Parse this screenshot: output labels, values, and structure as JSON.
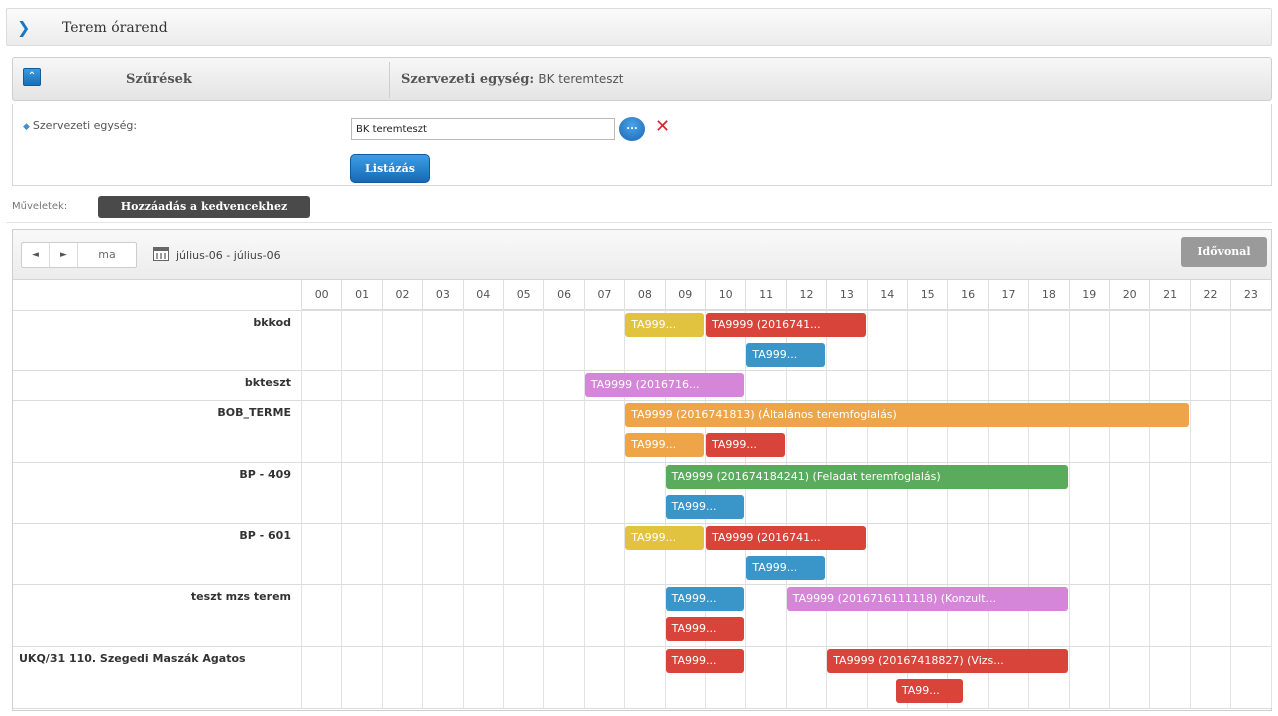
{
  "header": {
    "chevron_icon": "chevron-right-icon",
    "title": "Terem órarend"
  },
  "filters": {
    "collapse_icon": "collapse-up-icon",
    "label": "Szűrések",
    "summary_key": "Szervezeti egység:",
    "summary_value": "BK teremteszt"
  },
  "filter_form": {
    "field_label": "Szervezeti egység:",
    "field_value": "BK teremteszt",
    "browse_label": "...",
    "clear_label": "✕",
    "list_button": "Listázás"
  },
  "operations": {
    "label": "Műveletek:",
    "favorite_button": "Hozzáadás a kedvencekhez"
  },
  "scheduler": {
    "prev_label": "◄",
    "next_label": "►",
    "today_label": "ma",
    "date_range": "július-06 - július-06",
    "timeline_button": "Idővonal",
    "hours": [
      "00",
      "01",
      "02",
      "03",
      "04",
      "05",
      "06",
      "07",
      "08",
      "09",
      "10",
      "11",
      "12",
      "13",
      "14",
      "15",
      "16",
      "17",
      "18",
      "19",
      "20",
      "21",
      "22",
      "23"
    ],
    "colors": {
      "yellow": "#e2c340",
      "red": "#d9443a",
      "blue": "#3a95c8",
      "purple": "#d686d8",
      "orange": "#eea54a",
      "green": "#5aab5c"
    },
    "rows": [
      {
        "name": "bkkod",
        "events": [
          {
            "label": "TA999...",
            "start": 8,
            "end": 10,
            "lane": 0,
            "color": "yellow"
          },
          {
            "label": "TA9999 (2016741...",
            "start": 10,
            "end": 14,
            "lane": 0,
            "color": "red"
          },
          {
            "label": "TA999...",
            "start": 11,
            "end": 13,
            "lane": 1,
            "color": "blue"
          }
        ]
      },
      {
        "name": "bkteszt",
        "events": [
          {
            "label": "TA9999 (2016716...",
            "start": 7,
            "end": 11,
            "lane": 0,
            "color": "purple"
          }
        ]
      },
      {
        "name": "BOB_TERME",
        "events": [
          {
            "label": "TA9999 (2016741813) (Általános teremfoglalás)",
            "start": 8,
            "end": 22,
            "lane": 0,
            "color": "orange"
          },
          {
            "label": "TA999...",
            "start": 8,
            "end": 10,
            "lane": 1,
            "color": "orange"
          },
          {
            "label": "TA999...",
            "start": 10,
            "end": 12,
            "lane": 1,
            "color": "red"
          }
        ]
      },
      {
        "name": "BP - 409",
        "events": [
          {
            "label": "TA9999 (201674184241) (Feladat teremfoglalás)",
            "start": 9,
            "end": 19,
            "lane": 0,
            "color": "green"
          },
          {
            "label": "TA999...",
            "start": 9,
            "end": 11,
            "lane": 1,
            "color": "blue"
          }
        ]
      },
      {
        "name": "BP - 601",
        "events": [
          {
            "label": "TA999...",
            "start": 8,
            "end": 10,
            "lane": 0,
            "color": "yellow"
          },
          {
            "label": "TA9999 (2016741...",
            "start": 10,
            "end": 14,
            "lane": 0,
            "color": "red"
          },
          {
            "label": "TA999...",
            "start": 11,
            "end": 13,
            "lane": 1,
            "color": "blue"
          }
        ]
      },
      {
        "name": "teszt mzs terem",
        "events": [
          {
            "label": "TA999...",
            "start": 9,
            "end": 11,
            "lane": 0,
            "color": "blue"
          },
          {
            "label": "TA9999 (2016716111118) (Konzult...",
            "start": 12,
            "end": 19,
            "lane": 0,
            "color": "purple"
          },
          {
            "label": "TA999...",
            "start": 9,
            "end": 11,
            "lane": 1,
            "color": "red"
          }
        ]
      },
      {
        "name": "UKQ/31 110. Szegedi Maszák Agatos",
        "events": [
          {
            "label": "TA999...",
            "start": 9,
            "end": 11,
            "lane": 0,
            "color": "red"
          },
          {
            "label": "TA9999 (20167418827) (Vizs...",
            "start": 13,
            "end": 19,
            "lane": 0,
            "color": "red"
          },
          {
            "label": "TA99...",
            "start": 14.7,
            "end": 16.4,
            "lane": 1,
            "color": "red"
          }
        ]
      }
    ]
  }
}
